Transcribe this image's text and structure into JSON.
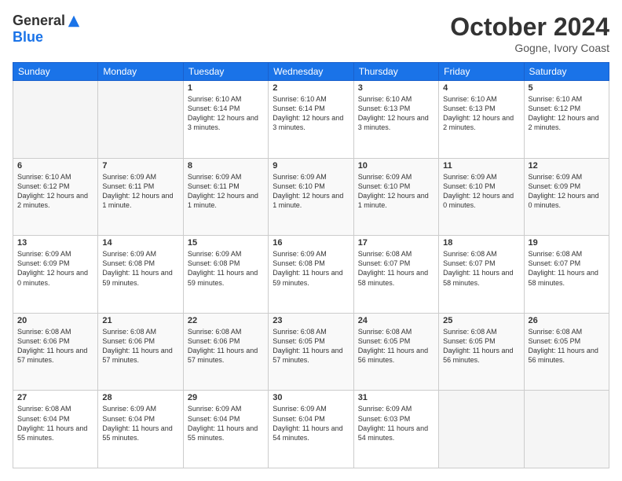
{
  "header": {
    "logo_general": "General",
    "logo_blue": "Blue",
    "month": "October 2024",
    "location": "Gogne, Ivory Coast"
  },
  "days_of_week": [
    "Sunday",
    "Monday",
    "Tuesday",
    "Wednesday",
    "Thursday",
    "Friday",
    "Saturday"
  ],
  "weeks": [
    [
      {
        "day": "",
        "info": "",
        "empty": true
      },
      {
        "day": "",
        "info": "",
        "empty": true
      },
      {
        "day": "1",
        "info": "Sunrise: 6:10 AM\nSunset: 6:14 PM\nDaylight: 12 hours and 3 minutes.",
        "empty": false
      },
      {
        "day": "2",
        "info": "Sunrise: 6:10 AM\nSunset: 6:14 PM\nDaylight: 12 hours and 3 minutes.",
        "empty": false
      },
      {
        "day": "3",
        "info": "Sunrise: 6:10 AM\nSunset: 6:13 PM\nDaylight: 12 hours and 3 minutes.",
        "empty": false
      },
      {
        "day": "4",
        "info": "Sunrise: 6:10 AM\nSunset: 6:13 PM\nDaylight: 12 hours and 2 minutes.",
        "empty": false
      },
      {
        "day": "5",
        "info": "Sunrise: 6:10 AM\nSunset: 6:12 PM\nDaylight: 12 hours and 2 minutes.",
        "empty": false
      }
    ],
    [
      {
        "day": "6",
        "info": "Sunrise: 6:10 AM\nSunset: 6:12 PM\nDaylight: 12 hours and 2 minutes.",
        "empty": false
      },
      {
        "day": "7",
        "info": "Sunrise: 6:09 AM\nSunset: 6:11 PM\nDaylight: 12 hours and 1 minute.",
        "empty": false
      },
      {
        "day": "8",
        "info": "Sunrise: 6:09 AM\nSunset: 6:11 PM\nDaylight: 12 hours and 1 minute.",
        "empty": false
      },
      {
        "day": "9",
        "info": "Sunrise: 6:09 AM\nSunset: 6:10 PM\nDaylight: 12 hours and 1 minute.",
        "empty": false
      },
      {
        "day": "10",
        "info": "Sunrise: 6:09 AM\nSunset: 6:10 PM\nDaylight: 12 hours and 1 minute.",
        "empty": false
      },
      {
        "day": "11",
        "info": "Sunrise: 6:09 AM\nSunset: 6:10 PM\nDaylight: 12 hours and 0 minutes.",
        "empty": false
      },
      {
        "day": "12",
        "info": "Sunrise: 6:09 AM\nSunset: 6:09 PM\nDaylight: 12 hours and 0 minutes.",
        "empty": false
      }
    ],
    [
      {
        "day": "13",
        "info": "Sunrise: 6:09 AM\nSunset: 6:09 PM\nDaylight: 12 hours and 0 minutes.",
        "empty": false
      },
      {
        "day": "14",
        "info": "Sunrise: 6:09 AM\nSunset: 6:08 PM\nDaylight: 11 hours and 59 minutes.",
        "empty": false
      },
      {
        "day": "15",
        "info": "Sunrise: 6:09 AM\nSunset: 6:08 PM\nDaylight: 11 hours and 59 minutes.",
        "empty": false
      },
      {
        "day": "16",
        "info": "Sunrise: 6:09 AM\nSunset: 6:08 PM\nDaylight: 11 hours and 59 minutes.",
        "empty": false
      },
      {
        "day": "17",
        "info": "Sunrise: 6:08 AM\nSunset: 6:07 PM\nDaylight: 11 hours and 58 minutes.",
        "empty": false
      },
      {
        "day": "18",
        "info": "Sunrise: 6:08 AM\nSunset: 6:07 PM\nDaylight: 11 hours and 58 minutes.",
        "empty": false
      },
      {
        "day": "19",
        "info": "Sunrise: 6:08 AM\nSunset: 6:07 PM\nDaylight: 11 hours and 58 minutes.",
        "empty": false
      }
    ],
    [
      {
        "day": "20",
        "info": "Sunrise: 6:08 AM\nSunset: 6:06 PM\nDaylight: 11 hours and 57 minutes.",
        "empty": false
      },
      {
        "day": "21",
        "info": "Sunrise: 6:08 AM\nSunset: 6:06 PM\nDaylight: 11 hours and 57 minutes.",
        "empty": false
      },
      {
        "day": "22",
        "info": "Sunrise: 6:08 AM\nSunset: 6:06 PM\nDaylight: 11 hours and 57 minutes.",
        "empty": false
      },
      {
        "day": "23",
        "info": "Sunrise: 6:08 AM\nSunset: 6:05 PM\nDaylight: 11 hours and 57 minutes.",
        "empty": false
      },
      {
        "day": "24",
        "info": "Sunrise: 6:08 AM\nSunset: 6:05 PM\nDaylight: 11 hours and 56 minutes.",
        "empty": false
      },
      {
        "day": "25",
        "info": "Sunrise: 6:08 AM\nSunset: 6:05 PM\nDaylight: 11 hours and 56 minutes.",
        "empty": false
      },
      {
        "day": "26",
        "info": "Sunrise: 6:08 AM\nSunset: 6:05 PM\nDaylight: 11 hours and 56 minutes.",
        "empty": false
      }
    ],
    [
      {
        "day": "27",
        "info": "Sunrise: 6:08 AM\nSunset: 6:04 PM\nDaylight: 11 hours and 55 minutes.",
        "empty": false
      },
      {
        "day": "28",
        "info": "Sunrise: 6:09 AM\nSunset: 6:04 PM\nDaylight: 11 hours and 55 minutes.",
        "empty": false
      },
      {
        "day": "29",
        "info": "Sunrise: 6:09 AM\nSunset: 6:04 PM\nDaylight: 11 hours and 55 minutes.",
        "empty": false
      },
      {
        "day": "30",
        "info": "Sunrise: 6:09 AM\nSunset: 6:04 PM\nDaylight: 11 hours and 54 minutes.",
        "empty": false
      },
      {
        "day": "31",
        "info": "Sunrise: 6:09 AM\nSunset: 6:03 PM\nDaylight: 11 hours and 54 minutes.",
        "empty": false
      },
      {
        "day": "",
        "info": "",
        "empty": true
      },
      {
        "day": "",
        "info": "",
        "empty": true
      }
    ]
  ]
}
